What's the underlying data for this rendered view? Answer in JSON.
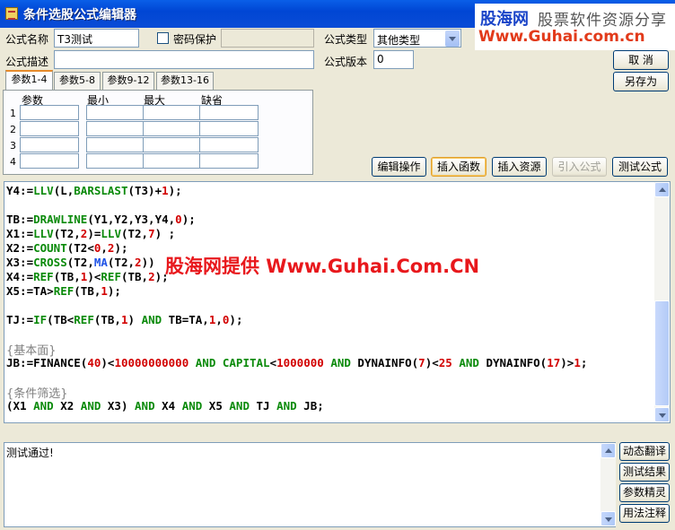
{
  "window": {
    "title": "条件选股公式编辑器"
  },
  "brand": {
    "logo": "股海网",
    "tagline": "股票软件资源分享",
    "url": "Www.Guhai.com.cn"
  },
  "form": {
    "name_label": "公式名称",
    "name_value": "T3测试",
    "password_label": "密码保护",
    "password_checked": false,
    "type_label": "公式类型",
    "type_value": "其他类型",
    "desc_label": "公式描述",
    "desc_value": "",
    "version_label": "公式版本",
    "version_value": "0"
  },
  "buttons": {
    "cancel": "取  消",
    "save_as": "另存为",
    "edit_op": "编辑操作",
    "insert_func": "插入函数",
    "insert_res": "插入资源",
    "import_formula": "引入公式",
    "test_formula": "测试公式"
  },
  "tabs": [
    {
      "label": "参数1-4",
      "active": true
    },
    {
      "label": "参数5-8",
      "active": false
    },
    {
      "label": "参数9-12",
      "active": false
    },
    {
      "label": "参数13-16",
      "active": false
    }
  ],
  "params": {
    "headers": [
      "参数",
      "最小",
      "最大",
      "缺省"
    ],
    "rows": [
      "1",
      "2",
      "3",
      "4"
    ]
  },
  "watermark": "股海网提供 Www.Guhai.Com.CN",
  "result": {
    "text": "测试通过!"
  },
  "side_buttons": [
    "动态翻译",
    "测试结果",
    "参数精灵",
    "用法注释"
  ],
  "colors": {
    "keyword": "#0a8a0a",
    "number": "#d20000",
    "function": "#1e52e6",
    "comment": "#808080",
    "title_bar": "#0a5fe8"
  }
}
